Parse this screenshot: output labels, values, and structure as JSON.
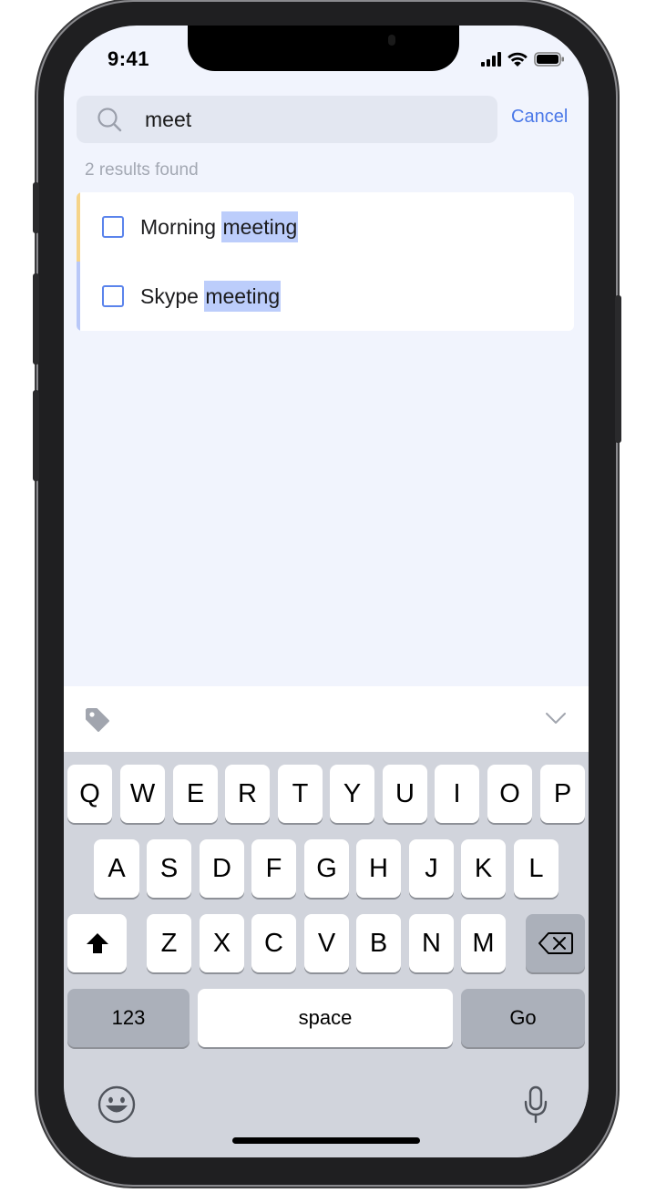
{
  "status_bar": {
    "time": "9:41"
  },
  "search": {
    "query": "meet",
    "cancel_label": "Cancel"
  },
  "results": {
    "count_text": "2 results found",
    "items": [
      {
        "prefix": "Morning ",
        "match": "meeting",
        "accent": "#f6d48a",
        "checked": false
      },
      {
        "prefix": "Skype ",
        "match": "meeting",
        "accent": "#b9c8f8",
        "checked": false
      }
    ]
  },
  "toolbar": {
    "left_icon": "tag-icon",
    "right_icon": "chevron-down-icon"
  },
  "keyboard": {
    "row1": [
      "Q",
      "W",
      "E",
      "R",
      "T",
      "Y",
      "U",
      "I",
      "O",
      "P"
    ],
    "row2": [
      "A",
      "S",
      "D",
      "F",
      "G",
      "H",
      "J",
      "K",
      "L"
    ],
    "row3": [
      "Z",
      "X",
      "C",
      "V",
      "B",
      "N",
      "M"
    ],
    "numbers_label": "123",
    "space_label": "space",
    "go_label": "Go"
  },
  "colors": {
    "accent": "#4a78e8",
    "highlight": "#bccdfb",
    "background": "#f1f4fd"
  }
}
